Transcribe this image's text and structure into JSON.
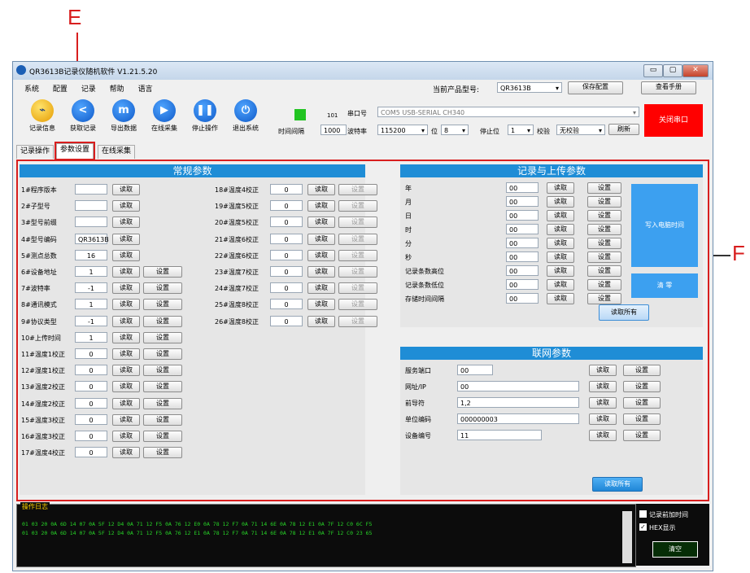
{
  "annotations": {
    "e": "E",
    "f": "F"
  },
  "window": {
    "title": "QR3613B记录仪随机软件  V1.21.5.20",
    "controls": [
      "▭",
      "▢",
      "✕"
    ]
  },
  "menu": [
    "系统",
    "配置",
    "记录",
    "帮助",
    "语言"
  ],
  "product": {
    "label": "当前产品型号:",
    "value": "QR3613B",
    "save": "保存配置",
    "manual": "查看手册"
  },
  "toolbar": [
    {
      "label": "记录信息",
      "icon": "chart-icon",
      "glyph": "⌁"
    },
    {
      "label": "获取记录",
      "icon": "share-icon",
      "glyph": "<"
    },
    {
      "label": "导出数据",
      "icon": "export-icon",
      "glyph": "m"
    },
    {
      "label": "在线采集",
      "icon": "play-icon",
      "glyph": "▶"
    },
    {
      "label": "停止操作",
      "icon": "pause-icon",
      "glyph": "❚❚"
    },
    {
      "label": "退出系统",
      "icon": "power-icon",
      "glyph": "⏻"
    }
  ],
  "serial": {
    "interval_label": "时间间隔",
    "interval": "1000",
    "counter": "101",
    "port_label": "串口号",
    "port": "COM5 USB-SERIAL CH340",
    "baud_label": "波特率",
    "baud": "115200",
    "bits_label": "位",
    "bits": "8",
    "stop_label": "停止位",
    "stop": "1",
    "parity_label": "校验",
    "parity": "无校验",
    "refresh": "刷新",
    "close": "关闭串口"
  },
  "tabs": [
    "记录操作",
    "参数设置",
    "在线采集"
  ],
  "common": {
    "title": "常规参数",
    "read": "读取",
    "set": "设置",
    "left": [
      {
        "label": "1#程序版本",
        "value": "",
        "set": false
      },
      {
        "label": "2#子型号",
        "value": "",
        "set": false
      },
      {
        "label": "3#型号前缀",
        "value": "",
        "set": false
      },
      {
        "label": "4#型号编码",
        "value": "QR3613B",
        "set": false
      },
      {
        "label": "5#测点总数",
        "value": "16",
        "set": false
      },
      {
        "label": "6#设备地址",
        "value": "1",
        "set": true
      },
      {
        "label": "7#波特率",
        "value": "-1",
        "set": true
      },
      {
        "label": "8#通讯模式",
        "value": "1",
        "set": true
      },
      {
        "label": "9#协议类型",
        "value": "-1",
        "set": true
      },
      {
        "label": "10#上传时间",
        "value": "1",
        "set": true
      },
      {
        "label": "11#温度1校正",
        "value": "0",
        "set": true
      },
      {
        "label": "12#湿度1校正",
        "value": "0",
        "set": true
      },
      {
        "label": "13#温度2校正",
        "value": "0",
        "set": true
      },
      {
        "label": "14#湿度2校正",
        "value": "0",
        "set": true
      },
      {
        "label": "15#温度3校正",
        "value": "0",
        "set": true
      },
      {
        "label": "16#温度3校正",
        "value": "0",
        "set": true
      },
      {
        "label": "17#温度4校正",
        "value": "0",
        "set": true
      }
    ],
    "right": [
      {
        "label": "18#温度4校正",
        "value": "0"
      },
      {
        "label": "19#温度5校正",
        "value": "0"
      },
      {
        "label": "20#温度5校正",
        "value": "0"
      },
      {
        "label": "21#温度6校正",
        "value": "0"
      },
      {
        "label": "22#温度6校正",
        "value": "0"
      },
      {
        "label": "23#温度7校正",
        "value": "0"
      },
      {
        "label": "24#温度7校正",
        "value": "0"
      },
      {
        "label": "25#温度8校正",
        "value": "0"
      },
      {
        "label": "26#温度8校正",
        "value": "0"
      }
    ]
  },
  "record": {
    "title": "记录与上传参数",
    "rows": [
      {
        "label": "年",
        "value": "00"
      },
      {
        "label": "月",
        "value": "00"
      },
      {
        "label": "日",
        "value": "00"
      },
      {
        "label": "时",
        "value": "00"
      },
      {
        "label": "分",
        "value": "00"
      },
      {
        "label": "秒",
        "value": "00"
      },
      {
        "label": "记录条数高位",
        "value": "00"
      },
      {
        "label": "记录条数低位",
        "value": "00"
      },
      {
        "label": "存储时间间隔",
        "value": "00"
      }
    ],
    "write_time": "写入电脑时间",
    "clear": "清 零",
    "read_all": "读取所有"
  },
  "network": {
    "title": "联网参数",
    "rows": [
      {
        "label": "服务端口",
        "value": "00"
      },
      {
        "label": "网址/IP",
        "value": "00"
      },
      {
        "label": "前导符",
        "value": "1,2"
      },
      {
        "label": "单位编码",
        "value": "000000003"
      },
      {
        "label": "设备编号",
        "value": "11"
      }
    ],
    "read_all": "读取所有"
  },
  "log": {
    "title": "操作日志",
    "lines": [
      "01 03 20 0A 6D 14 07 0A 5F 12 D4 0A 71 12 F5 0A 76 12 E0 0A 78 12 F7 0A 71 14 6E 0A 78 12 E1 0A 7F 12 C0 6C F5",
      "01 03 20 0A 6D 14 07 0A 5F 12 D4 0A 71 12 F5 0A 76 12 E1 0A 78 12 F7 0A 71 14 6E 0A 78 12 E1 0A 7F 12 C0 23 65"
    ],
    "opt1": "记录前加时间",
    "opt2": "HEX显示",
    "clear": "清空"
  }
}
